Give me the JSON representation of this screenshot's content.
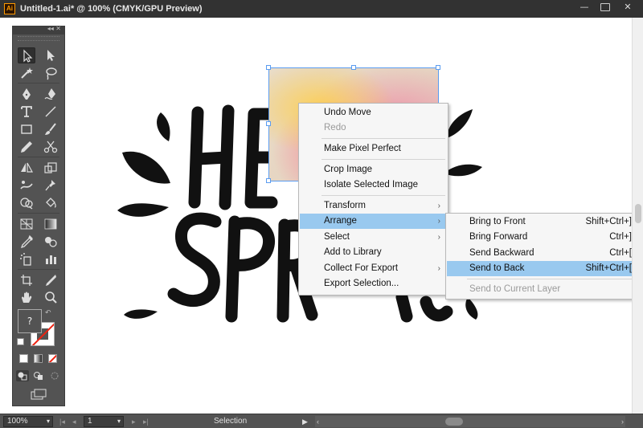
{
  "window": {
    "app_logo": "Ai",
    "title": "Untitled-1.ai* @ 100% (CMYK/GPU Preview)",
    "minimize_glyph": "—",
    "close_glyph": "✕"
  },
  "tools_panel": {
    "collapse_glyph": "◂◂ ✕",
    "fill_label": "?"
  },
  "artwork": {
    "line1": "HELLO",
    "line2": "SPRING",
    "ink_color": "#111111"
  },
  "context_menu": {
    "items": [
      {
        "label": "Undo Move",
        "enabled": true
      },
      {
        "label": "Redo",
        "enabled": false
      },
      {
        "label": "Make Pixel Perfect",
        "enabled": true
      },
      {
        "label": "Crop Image",
        "enabled": true
      },
      {
        "label": "Isolate Selected Image",
        "enabled": true
      },
      {
        "label": "Transform",
        "enabled": true,
        "submenu": true
      },
      {
        "label": "Arrange",
        "enabled": true,
        "submenu": true,
        "highlighted": true
      },
      {
        "label": "Select",
        "enabled": true,
        "submenu": true
      },
      {
        "label": "Add to Library",
        "enabled": true
      },
      {
        "label": "Collect For Export",
        "enabled": true,
        "submenu": true
      },
      {
        "label": "Export Selection...",
        "enabled": true
      }
    ],
    "submenu_arrow": "›"
  },
  "arrange_submenu": {
    "items": [
      {
        "label": "Bring to Front",
        "shortcut": "Shift+Ctrl+]"
      },
      {
        "label": "Bring Forward",
        "shortcut": "Ctrl+]"
      },
      {
        "label": "Send Backward",
        "shortcut": "Ctrl+["
      },
      {
        "label": "Send to Back",
        "shortcut": "Shift+Ctrl+[",
        "highlighted": true
      },
      {
        "label": "Send to Current Layer",
        "shortcut": "",
        "enabled": false
      }
    ]
  },
  "status_bar": {
    "zoom": "100%",
    "artboard": "1",
    "mode": "Selection",
    "dropdown_glyph": "▾",
    "nav_first": "|◂",
    "nav_prev": "◂",
    "nav_next": "▸",
    "nav_last": "▸|",
    "play_glyph": "▶",
    "scroll_left": "‹",
    "scroll_right": "›"
  },
  "colors": {
    "menu_highlight": "#99c9ef",
    "selection_blue": "#5a9cf0",
    "panel_gray": "#535353",
    "titlebar": "#323232"
  }
}
